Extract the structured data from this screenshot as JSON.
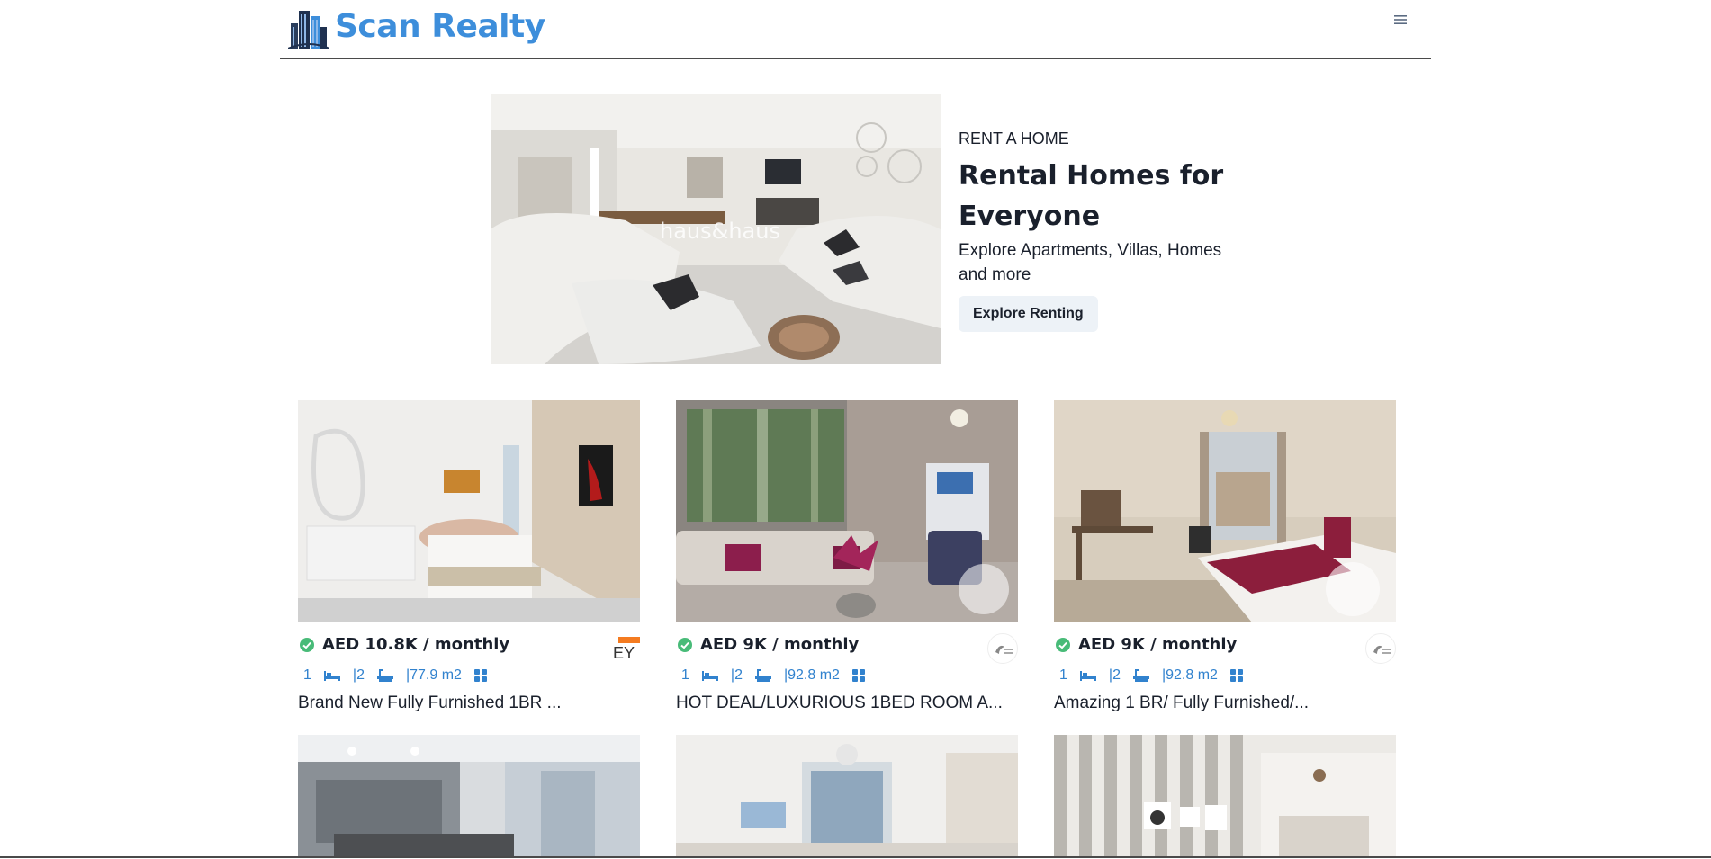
{
  "brand": {
    "name": "Scan Realty"
  },
  "header": {
    "menu_icon": "hamburger-icon"
  },
  "hero": {
    "eyebrow": "RENT A HOME",
    "title_line1": "Rental Homes for",
    "title_line2": "Everyone",
    "description_line1": "Explore Apartments, Villas, Homes",
    "description_line2": "and more",
    "button_label": "Explore Renting",
    "image_watermark": "haus&haus"
  },
  "listings": [
    {
      "price": "AED 10.8K / monthly",
      "beds": "1",
      "baths": "|2",
      "area": "|77.9 m2",
      "title": "Brand New Fully Furnished 1BR ..."
    },
    {
      "price": "AED 9K / monthly",
      "beds": "1",
      "baths": "|2",
      "area": "|92.8 m2",
      "title": "HOT DEAL/LUXURIOUS 1BED ROOM A..."
    },
    {
      "price": "AED 9K / monthly",
      "beds": "1",
      "baths": "|2",
      "area": "|92.8 m2",
      "title": "Amazing 1 BR/ Fully Furnished/..."
    },
    {
      "price": "",
      "beds": "",
      "baths": "",
      "area": "",
      "title": ""
    },
    {
      "price": "",
      "beds": "",
      "baths": "",
      "area": "",
      "title": ""
    },
    {
      "price": "",
      "beds": "",
      "baths": "",
      "area": "",
      "title": ""
    }
  ],
  "colors": {
    "brand": "#3d8edb",
    "accent": "#3182ce",
    "verified": "#48bb78",
    "button_bg": "#edf2f7"
  }
}
